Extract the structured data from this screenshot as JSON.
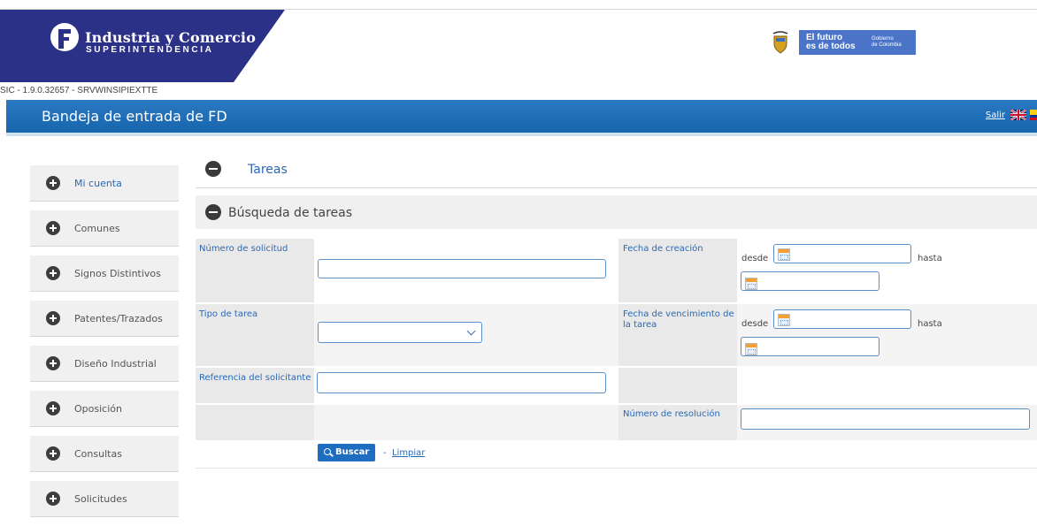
{
  "header": {
    "brand_title": "Industria y Comercio",
    "brand_subtitle": "SUPERINTENDENCIA",
    "gov_line1": "El futuro",
    "gov_line2": "es de todos",
    "gov_line3": "Gobierno",
    "gov_line4": "de Colombia",
    "version": "SIC - 1.9.0.32657 - SRVWINSIPIEXTTE",
    "page_title": "Bandeja de entrada de FD",
    "logout": "Salir"
  },
  "sidebar": {
    "items": [
      {
        "label": "Mi cuenta"
      },
      {
        "label": "Comunes"
      },
      {
        "label": "Signos Distintivos"
      },
      {
        "label": "Patentes/Trazados"
      },
      {
        "label": "Diseño Industrial"
      },
      {
        "label": "Oposición"
      },
      {
        "label": "Consultas"
      },
      {
        "label": "Solicitudes"
      }
    ]
  },
  "main": {
    "section_title": "Tareas",
    "search_title": "Búsqueda de tareas",
    "fields": {
      "numero_solicitud": {
        "label": "Número de solicitud",
        "value": ""
      },
      "tipo_tarea": {
        "label": "Tipo de tarea",
        "value": ""
      },
      "referencia": {
        "label": "Referencia del solicitante",
        "value": ""
      },
      "fecha_creacion": {
        "label": "Fecha de creación"
      },
      "fecha_vencimiento": {
        "label": "Fecha de vencimiento de la tarea"
      },
      "numero_resolucion": {
        "label": "Número de resolución",
        "value": ""
      },
      "desde": "desde",
      "hasta": "hasta"
    },
    "buttons": {
      "buscar": "Buscar",
      "separator": "-",
      "limpiar": "Limpiar"
    }
  }
}
